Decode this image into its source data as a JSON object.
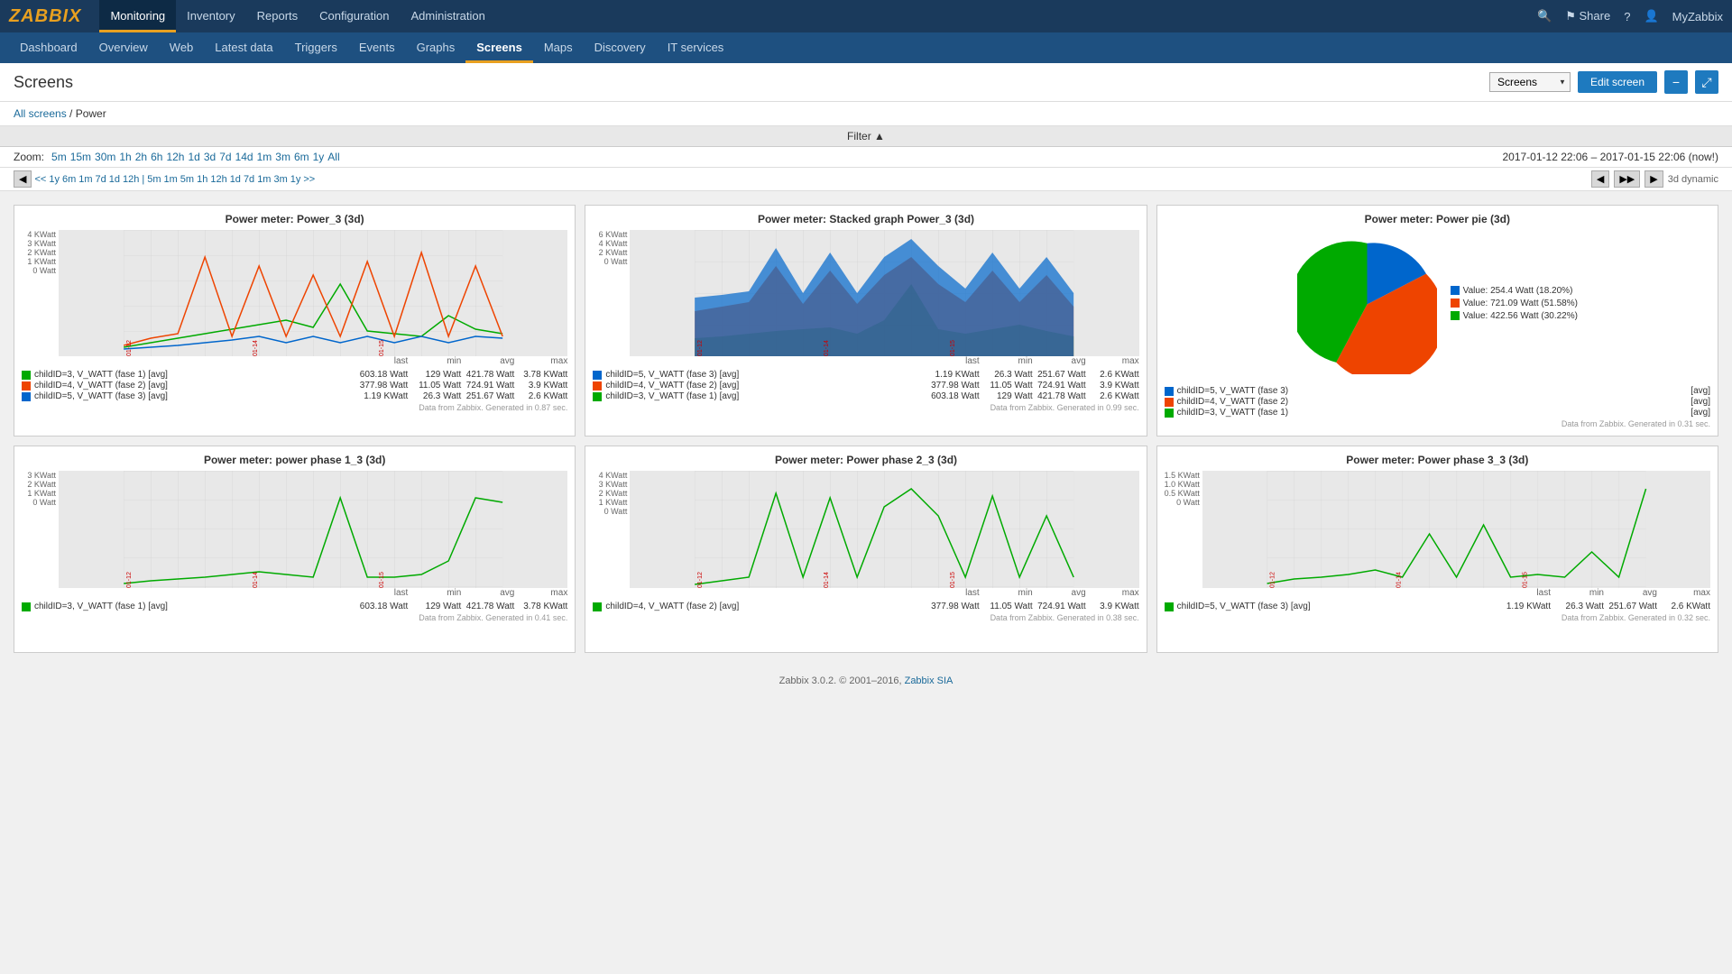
{
  "app": {
    "logo": "ZABBIX",
    "myzabbix": "MyZabbix"
  },
  "topnav": {
    "items": [
      {
        "label": "Monitoring",
        "active": true
      },
      {
        "label": "Inventory",
        "active": false
      },
      {
        "label": "Reports",
        "active": false
      },
      {
        "label": "Configuration",
        "active": false
      },
      {
        "label": "Administration",
        "active": false
      }
    ],
    "icons": {
      "search": "🔍",
      "share": "Share",
      "help": "?",
      "user": "👤"
    }
  },
  "secondnav": {
    "items": [
      {
        "label": "Dashboard"
      },
      {
        "label": "Overview"
      },
      {
        "label": "Web"
      },
      {
        "label": "Latest data"
      },
      {
        "label": "Triggers"
      },
      {
        "label": "Events"
      },
      {
        "label": "Graphs"
      },
      {
        "label": "Screens",
        "active": true
      },
      {
        "label": "Maps"
      },
      {
        "label": "Discovery"
      },
      {
        "label": "IT services"
      }
    ]
  },
  "page": {
    "title": "Screens",
    "breadcrumb_all": "All screens",
    "breadcrumb_current": "Power",
    "filter_label": "Filter ▲",
    "screens_select": "Screens",
    "edit_screen": "Edit screen",
    "icon_minus": "−",
    "icon_expand": "⤢"
  },
  "zoom": {
    "label": "Zoom:",
    "options": [
      "5m",
      "15m",
      "30m",
      "1h",
      "2h",
      "6h",
      "12h",
      "1d",
      "3d",
      "7d",
      "14d",
      "1m",
      "3m",
      "6m",
      "1y",
      "All"
    ],
    "time_range": "2017-01-12 22:06 – 2017-01-15 22:06 (now!)"
  },
  "navigation": {
    "prev_arrow": "◀",
    "nav_items": [
      "<<",
      "1y",
      "6m",
      "1m",
      "7d",
      "1d",
      "12h",
      "5m",
      "1m",
      "5m",
      "1h",
      "12h",
      "1d",
      "7d",
      "1m",
      "3m",
      "1y",
      ">>"
    ],
    "right_arrows": [
      "◀▶"
    ],
    "period_label": "3d dynamic"
  },
  "charts": {
    "top_row": [
      {
        "title": "Power meter: Power_3 (3d)",
        "type": "line",
        "y_labels": [
          "4 KWatt",
          "3 KWatt",
          "2 KWatt",
          "1 KWatt",
          "0 Watt"
        ],
        "colors": [
          "#00aa00",
          "#ee4400",
          "#0066cc"
        ],
        "legend_header": [
          "last",
          "min",
          "avg",
          "max"
        ],
        "legend_rows": [
          {
            "color": "#00aa00",
            "label": "childID=3, V_WATT (fase 1)",
            "tag": "[avg]",
            "last": "603.18 Watt",
            "min": "129 Watt",
            "avg": "421.78 Watt",
            "max": "3.78 KWatt"
          },
          {
            "color": "#ee4400",
            "label": "childID=4, V_WATT (fase 2)",
            "tag": "[avg]",
            "last": "377.98 Watt",
            "min": "11.05 Watt",
            "avg": "724.91 Watt",
            "max": "3.9 KWatt"
          },
          {
            "color": "#0066cc",
            "label": "childID=5, V_WATT (fase 3)",
            "tag": "[avg]",
            "last": "1.19 KWatt",
            "min": "26.3 Watt",
            "avg": "251.67 Watt",
            "max": "2.6 KWatt"
          }
        ]
      },
      {
        "title": "Power meter: Stacked graph Power_3 (3d)",
        "type": "stacked",
        "y_labels": [
          "6 KWatt",
          "4 KWatt",
          "2 KWatt",
          "0 Watt"
        ],
        "colors": [
          "#0066cc",
          "#ee4400",
          "#00aa00"
        ],
        "legend_header": [
          "last",
          "min",
          "avg",
          "max"
        ],
        "legend_rows": [
          {
            "color": "#0066cc",
            "label": "childID=5, V_WATT (fase 3)",
            "tag": "[avg]",
            "last": "1.19 KWatt",
            "min": "26.3 Watt",
            "avg": "251.67 Watt",
            "max": "2.6 KWatt"
          },
          {
            "color": "#ee4400",
            "label": "childID=4, V_WATT (fase 2)",
            "tag": "[avg]",
            "last": "377.98 Watt",
            "min": "11.05 Watt",
            "avg": "724.91 Watt",
            "max": "3.9 KWatt"
          },
          {
            "color": "#00aa00",
            "label": "childID=3, V_WATT (fase 1)",
            "tag": "[avg]",
            "last": "603.18 Watt",
            "min": "129 Watt",
            "avg": "421.78 Watt",
            "max": "2.6 KWatt"
          }
        ]
      },
      {
        "title": "Power meter: Power pie (3d)",
        "type": "pie",
        "pie_segments": [
          {
            "color": "#0066cc",
            "label": "childID=5, V_WATT (fase 3)",
            "tag": "[avg]",
            "percent": 18.2,
            "value": "254.4 Watt",
            "percent_label": "(18.20%)"
          },
          {
            "color": "#ee4400",
            "label": "childID=4, V_WATT (fase 2)",
            "tag": "[avg]",
            "percent": 51.58,
            "value": "721.09 Watt",
            "percent_label": "(51.58%)"
          },
          {
            "color": "#00aa00",
            "label": "childID=3, V_WATT (fase 1)",
            "tag": "[avg]",
            "percent": 30.22,
            "value": "422.56 Watt",
            "percent_label": "(30.22%)"
          }
        ],
        "legend_rows": [
          {
            "color": "#0066cc",
            "label": "childID=5, V_WATT (fase 3)",
            "tag": "[avg]"
          },
          {
            "color": "#ee4400",
            "label": "childID=4, V_WATT (fase 2)",
            "tag": "[avg]"
          },
          {
            "color": "#00aa00",
            "label": "childID=3, V_WATT (fase 1)",
            "tag": "[avg]"
          }
        ]
      }
    ],
    "bottom_row": [
      {
        "title": "Power meter: power phase 1_3 (3d)",
        "type": "line_single",
        "y_labels": [
          "3 KWatt",
          "2 KWatt",
          "1 KWatt",
          "0 Watt"
        ],
        "color": "#00aa00",
        "legend_rows": [
          {
            "color": "#00aa00",
            "label": "childID=3, V_WATT (fase 1)",
            "tag": "[avg]",
            "last": "603.18 Watt",
            "min": "129 Watt",
            "avg": "421.78 Watt",
            "max": "3.78 KWatt"
          }
        ]
      },
      {
        "title": "Power meter: Power phase 2_3 (3d)",
        "type": "line_single",
        "y_labels": [
          "4 KWatt",
          "3 KWatt",
          "2 KWatt",
          "1 KWatt",
          "0 Watt"
        ],
        "color": "#00aa00",
        "legend_rows": [
          {
            "color": "#00aa00",
            "label": "childID=4, V_WATT (fase 2)",
            "tag": "[avg]",
            "last": "377.98 Watt",
            "min": "11.05 Watt",
            "avg": "724.91 Watt",
            "max": "3.9 KWatt"
          }
        ]
      },
      {
        "title": "Power meter: Power phase 3_3 (3d)",
        "type": "line_single",
        "y_labels": [
          "1.5 KWatt",
          "1.0 KWatt",
          "0.5 KWatt",
          "0 Watt"
        ],
        "color": "#00aa00",
        "legend_rows": [
          {
            "color": "#00aa00",
            "label": "childID=5, V_WATT (fase 3)",
            "tag": "[avg]",
            "last": "1.19 KWatt",
            "min": "26.3 Watt",
            "avg": "251.67 Watt",
            "max": "2.6 KWatt"
          }
        ]
      }
    ]
  },
  "footer": {
    "text": "Zabbix 3.0.2. © 2001–2016,",
    "link_text": "Zabbix SIA"
  }
}
